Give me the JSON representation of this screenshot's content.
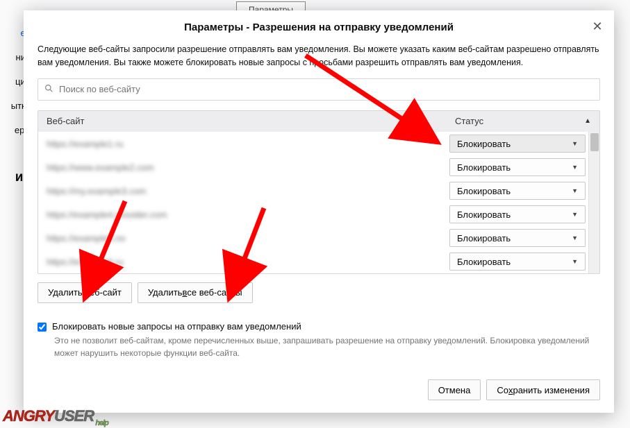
{
  "background": {
    "param_button": "Параметры",
    "sidebar": [
      "ее",
      "ния",
      "ции",
      "ытки",
      "ерж",
      "ие"
    ]
  },
  "dialog": {
    "title": "Параметры - Разрешения на отправку уведомлений",
    "description": "Следующие веб-сайты запросили разрешение отправлять вам уведомления. Вы можете указать каким веб-сайтам разрешено отправлять вам уведомления. Вы также можете блокировать новые запросы с просьбами разрешить отправлять вам уведомления.",
    "search_placeholder": "Поиск по веб-сайту",
    "columns": {
      "site": "Веб-сайт",
      "status": "Статус"
    },
    "rows": [
      {
        "site": "https://example1.ru",
        "status": "Блокировать",
        "selected": true
      },
      {
        "site": "https://www.example2.com",
        "status": "Блокировать",
        "selected": false
      },
      {
        "site": "https://my.example3.com",
        "status": "Блокировать",
        "selected": false
      },
      {
        "site": "https://example4.provider.com",
        "status": "Блокировать",
        "selected": false
      },
      {
        "site": "https://example5.no",
        "status": "Блокировать",
        "selected": false
      },
      {
        "site": "https://example6.ru",
        "status": "Блокировать",
        "selected": false
      }
    ],
    "buttons": {
      "remove": "Удалить веб-сайт",
      "remove_all_pre": "Удалить ",
      "remove_all_u": "в",
      "remove_all_post": "се веб-сайты"
    },
    "checkbox": {
      "label": "Блокировать новые запросы на отправку вам уведомлений",
      "checked": true,
      "hint": "Это не позволит веб-сайтам, кроме перечисленных выше, запрашивать разрешение на отправку уведомлений. Блокировка уведомлений может нарушить некоторые функции веб-сайта."
    },
    "footer": {
      "cancel": "Отмена",
      "save_pre": "Со",
      "save_u": "х",
      "save_post": "ранить изменения"
    }
  },
  "watermark": {
    "part1": "ANGRY",
    "part2": "USER",
    "help": "help"
  }
}
